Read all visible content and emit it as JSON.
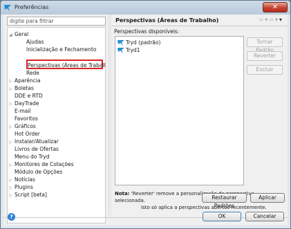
{
  "window": {
    "title": "Preferências",
    "close_symbol": "✕",
    "icon": "app-icon"
  },
  "filter": {
    "placeholder": "digite para filtrar"
  },
  "tree": {
    "items": [
      {
        "label": "Geral",
        "expanded": true,
        "level": 0
      },
      {
        "label": "Ajudas",
        "level": 1
      },
      {
        "label": "Inicialização e Fechamento",
        "level": 1
      },
      {
        "label": "Perspectivas (Áreas de Trabalho)",
        "level": 1,
        "selected": true
      },
      {
        "label": "Rede",
        "level": 1
      },
      {
        "label": "Aparência",
        "expandable": true,
        "level": 0
      },
      {
        "label": "Boletas",
        "expandable": true,
        "level": 0
      },
      {
        "label": "DDE e RTD",
        "level": 0
      },
      {
        "label": "DayTrade",
        "expandable": true,
        "level": 0
      },
      {
        "label": "E-mail",
        "level": 0
      },
      {
        "label": "Favoritos",
        "level": 0
      },
      {
        "label": "Gráficos",
        "expandable": true,
        "level": 0
      },
      {
        "label": "Hot Order",
        "level": 0
      },
      {
        "label": "Instalar/Atualizar",
        "expandable": true,
        "level": 0
      },
      {
        "label": "Livros de Ofertas",
        "level": 0
      },
      {
        "label": "Menu do Tryd",
        "level": 0
      },
      {
        "label": "Monitores de Cotações",
        "expandable": true,
        "level": 0
      },
      {
        "label": "Módulo de Opções",
        "level": 0
      },
      {
        "label": "Notícias",
        "expandable": true,
        "level": 0
      },
      {
        "label": "Plugins",
        "expandable": true,
        "level": 0
      },
      {
        "label": "Script [beta]",
        "expandable": true,
        "level": 0
      }
    ],
    "expand_symbol": "▷",
    "collapse_symbol": "◢"
  },
  "page": {
    "title": "Perspectivas (Áreas de Trabalho)",
    "nav_back": "⇦",
    "nav_back_menu": "▾",
    "nav_forward": "⇨",
    "nav_forward_menu": "▾",
    "nav_menu": "▾",
    "available_label": "Perspectivas disponíveis:",
    "perspectives": [
      {
        "label": "Tryd (padrão)"
      },
      {
        "label": "Tryd1"
      }
    ],
    "buttons": {
      "make_default": "Tornar Padrão",
      "revert": "Reverter",
      "delete": "Excluir"
    },
    "note": {
      "label": "Nota:",
      "line1": "'Reverter' remove a personalização da perspectiva selecionada.",
      "line2": "Isto só aplica a perspectivas abertas recentemente."
    },
    "restore_defaults": "Restaurar Padrões",
    "apply": "Aplicar"
  },
  "footer": {
    "ok": "OK",
    "cancel": "Cancelar",
    "help_symbol": "?"
  },
  "colors": {
    "selection_outline": "#d92424",
    "title_gradient_top": "#cfdbe8",
    "close_button": "#c8412f",
    "help_button": "#2f7fd6"
  }
}
